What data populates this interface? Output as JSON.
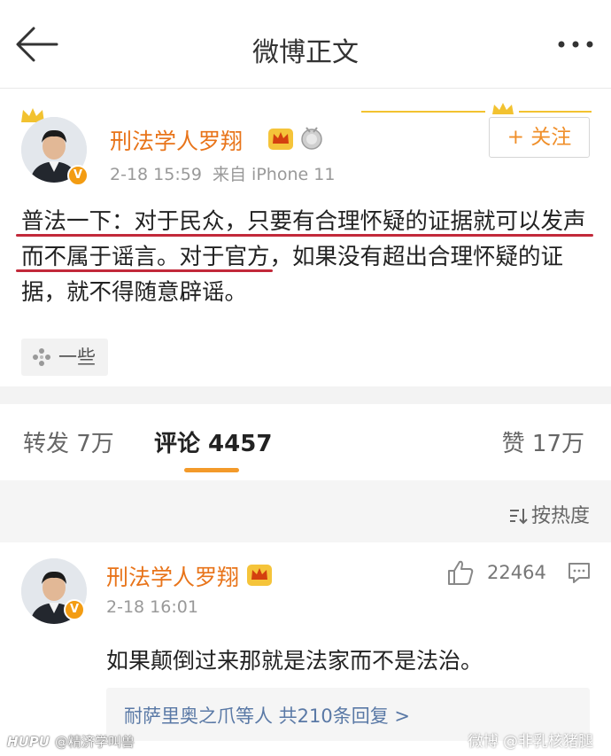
{
  "topbar": {
    "title": "微博正文"
  },
  "post": {
    "author": "刑法学人罗翔",
    "time": "2-18 15:59",
    "source": "来自 iPhone 11",
    "follow_label": "+ 关注",
    "text": "普法一下：对于民众，只要有合理怀疑的证据就可以发声而不属于谣言。对于官方，如果没有超出合理怀疑的证据，就不得随意辟谣。",
    "group_label": "一些",
    "badge": "V"
  },
  "tabs": {
    "repost": "转发 7万",
    "comment": "评论 4457",
    "like": "赞 17万"
  },
  "sort": {
    "label": "按热度"
  },
  "comment": {
    "author": "刑法学人罗翔",
    "time": "2-18 16:01",
    "likes": "22464",
    "text": "如果颠倒过来那就是法家而不是法治。",
    "reply_summary": "耐萨里奥之爪等人 共210条回复 >",
    "badge": "V"
  },
  "watermark": {
    "left_brand": "HUPU",
    "left_user": "@精济学叫兽",
    "right": "微博 @非乳核猪腿"
  },
  "colors": {
    "name_orange": "#e8741a",
    "underline_red": "#c2293a",
    "tab_accent": "#f39a2a",
    "link_blue": "#5a79a6"
  }
}
